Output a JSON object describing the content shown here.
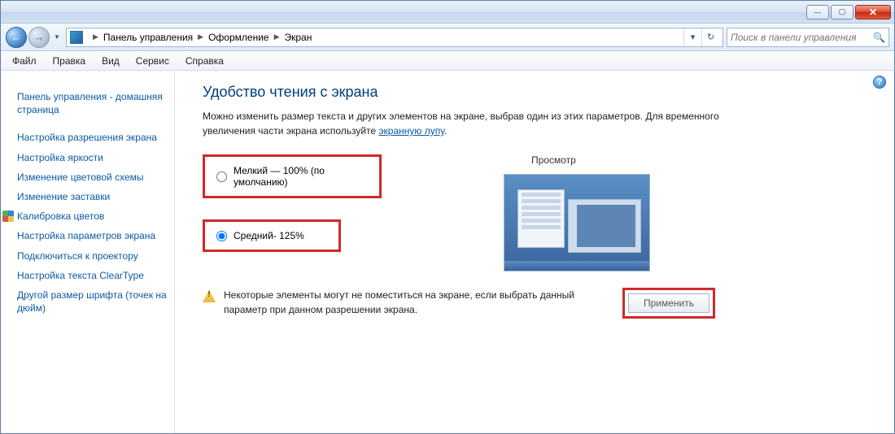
{
  "window_buttons": {
    "min": "—",
    "max": "▢",
    "close": "✕"
  },
  "breadcrumb": {
    "root": "Панель управления",
    "mid": "Оформление",
    "leaf": "Экран"
  },
  "search": {
    "placeholder": "Поиск в панели управления"
  },
  "menu": {
    "file": "Файл",
    "edit": "Правка",
    "view": "Вид",
    "service": "Сервис",
    "help": "Справка"
  },
  "sidebar": {
    "items": [
      "Панель управления - домашняя страница",
      "Настройка разрешения экрана",
      "Настройка яркости",
      "Изменение цветовой схемы",
      "Изменение заставки",
      "Калибровка цветов",
      "Настройка параметров экрана",
      "Подключиться к проектору",
      "Настройка текста ClearType",
      "Другой размер шрифта (точек на дюйм)"
    ]
  },
  "page": {
    "title": "Удобство чтения с экрана",
    "desc1": "Можно изменить размер текста и других элементов на экране, выбрав один из этих параметров. Для временного увеличения части экрана используйте ",
    "desc_link": "экранную лупу",
    "desc_end": ".",
    "option_small": "Мелкий — 100% (по умолчанию)",
    "option_medium": "Средний- 125%",
    "preview_label": "Просмотр",
    "warning": "Некоторые элементы могут не поместиться на экране, если выбрать данный параметр при данном разрешении экрана.",
    "apply": "Применить"
  }
}
